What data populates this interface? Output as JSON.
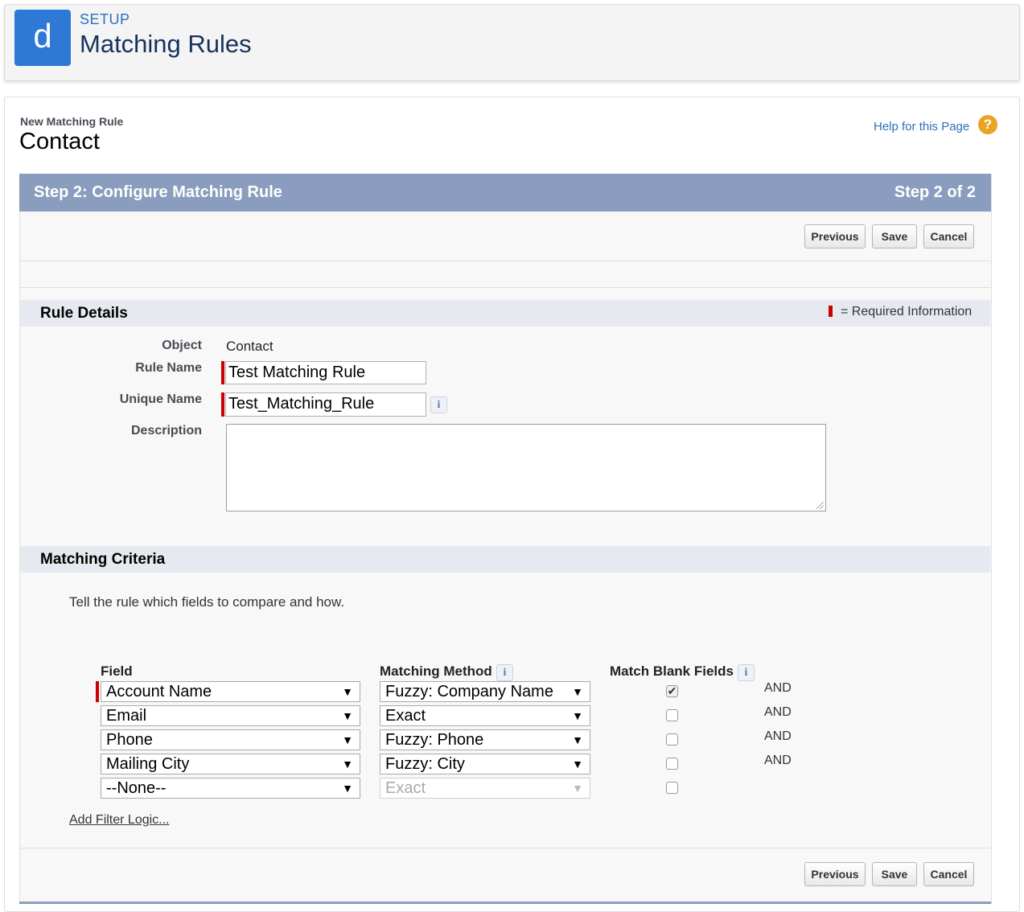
{
  "header": {
    "logo_letter": "d",
    "section": "SETUP",
    "title": "Matching Rules"
  },
  "page": {
    "breadcrumb": "New Matching Rule",
    "object_title": "Contact",
    "help_link": "Help for this Page",
    "help_icon": "?"
  },
  "step": {
    "title": "Step 2: Configure Matching Rule",
    "count": "Step 2 of 2"
  },
  "buttons": {
    "previous": "Previous",
    "save": "Save",
    "cancel": "Cancel"
  },
  "rule_details": {
    "section_title": "Rule Details",
    "required_info": "= Required Information",
    "object_label": "Object",
    "object_value": "Contact",
    "rule_name_label": "Rule Name",
    "rule_name_value": "Test Matching Rule",
    "unique_name_label": "Unique Name",
    "unique_name_value": "Test_Matching_Rule",
    "description_label": "Description",
    "info_icon": "i"
  },
  "matching_criteria": {
    "section_title": "Matching Criteria",
    "instructions": "Tell the rule which fields to compare and how.",
    "col_field": "Field",
    "col_method": "Matching Method",
    "col_blank": "Match Blank Fields",
    "rows": [
      {
        "field": "Account Name",
        "method": "Fuzzy: Company Name",
        "blank": "✔",
        "logic": "AND"
      },
      {
        "field": "Email",
        "method": "Exact",
        "blank": "",
        "logic": "AND"
      },
      {
        "field": "Phone",
        "method": "Fuzzy: Phone",
        "blank": "",
        "logic": "AND"
      },
      {
        "field": "Mailing City",
        "method": "Fuzzy: City",
        "blank": "",
        "logic": "AND"
      },
      {
        "field": "--None--",
        "method": "Exact",
        "blank": "",
        "logic": ""
      }
    ],
    "dropdown_arrow": "▼",
    "add_filter_logic": "Add Filter Logic..."
  },
  "colors": {
    "accent": "#2e79d6",
    "step_bar": "#8a9dbe",
    "required": "#cc0000",
    "link": "#2e6fbc"
  }
}
